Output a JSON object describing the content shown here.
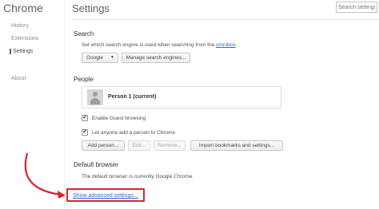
{
  "sidebar": {
    "brand": "Chrome",
    "items": [
      {
        "label": "History"
      },
      {
        "label": "Extensions"
      },
      {
        "label": "Settings"
      },
      {
        "label": "About"
      }
    ]
  },
  "header": {
    "title": "Settings",
    "search_placeholder": "Search settings"
  },
  "search_section": {
    "title": "Search",
    "description_prefix": "Set which search engine is used when searching from the ",
    "description_link": "omnibox",
    "description_suffix": ".",
    "engine_select": "Google",
    "manage_button": "Manage search engines..."
  },
  "people_section": {
    "title": "People",
    "person_name": "Person 1 (current)",
    "guest_checkbox": {
      "label": "Enable Guest browsing",
      "checked": true
    },
    "add_anyone_checkbox": {
      "label": "Let anyone add a person to Chrome",
      "checked": true
    },
    "buttons": {
      "add": "Add person...",
      "edit": "Edit...",
      "remove": "Remove...",
      "import": "Import bookmarks and settings..."
    }
  },
  "default_browser_section": {
    "title": "Default browser",
    "description": "The default browser is currently Google Chrome."
  },
  "advanced_link": "Show advanced settings...",
  "colors": {
    "link": "#3367d6",
    "highlight": "#d9242f"
  },
  "icons": {
    "checkmark": "✔",
    "dropdown": "▼"
  }
}
